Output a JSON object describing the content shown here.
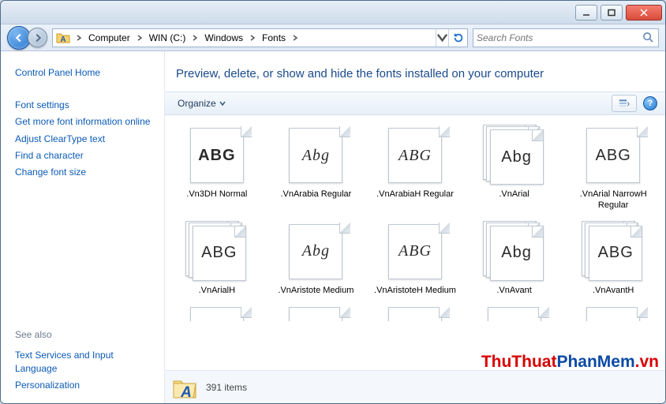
{
  "title_controls": {},
  "breadcrumb": [
    "Computer",
    "WIN (C:)",
    "Windows",
    "Fonts"
  ],
  "search": {
    "placeholder": "Search Fonts"
  },
  "sidebar": {
    "header": "Control Panel Home",
    "links": [
      "Font settings",
      "Get more font information online",
      "Adjust ClearType text",
      "Find a character",
      "Change font size"
    ],
    "seealso_header": "See also",
    "seealso": [
      "Text Services and Input Language",
      "Personalization"
    ]
  },
  "main": {
    "heading": "Preview, delete, or show and hide the fonts installed on your computer",
    "organize_label": "Organize"
  },
  "fonts": [
    {
      "label": ".Vn3DH  Normal",
      "sample": "ABG",
      "stack": false,
      "style": "font-family:Impact,Arial Black,sans-serif;font-weight:800"
    },
    {
      "label": ".VnArabia Regular",
      "sample": "Abg",
      "stack": false,
      "style": "font-family:'Brush Script MT',cursive;font-style:italic"
    },
    {
      "label": ".VnArabiaH Regular",
      "sample": "ABG",
      "stack": false,
      "style": "font-family:'Brush Script MT',cursive;font-style:italic"
    },
    {
      "label": ".VnArial",
      "sample": "Abg",
      "stack": true,
      "style": "font-family:Arial,sans-serif"
    },
    {
      "label": ".VnArial NarrowH Regular",
      "sample": "ABG",
      "stack": false,
      "style": "font-family:'Arial Narrow',Arial,sans-serif"
    },
    {
      "label": ".VnArialH",
      "sample": "ABG",
      "stack": true,
      "style": "font-family:Arial,sans-serif"
    },
    {
      "label": ".VnAristote Medium",
      "sample": "Abg",
      "stack": false,
      "style": "font-family:'Edwardian Script ITC',cursive;font-style:italic"
    },
    {
      "label": ".VnAristoteH Medium",
      "sample": "ABG",
      "stack": false,
      "style": "font-family:'Edwardian Script ITC',cursive;font-style:italic"
    },
    {
      "label": ".VnAvant",
      "sample": "Abg",
      "stack": true,
      "style": "font-family:'Century Gothic',Arial,sans-serif"
    },
    {
      "label": ".VnAvantH",
      "sample": "ABG",
      "stack": true,
      "style": "font-family:'Century Gothic',Arial,sans-serif"
    }
  ],
  "peek_row_count": 5,
  "status": {
    "count": "391 items"
  },
  "watermark": {
    "a": "ThuThuat",
    "b": "PhanMem",
    "c": ".vn"
  }
}
